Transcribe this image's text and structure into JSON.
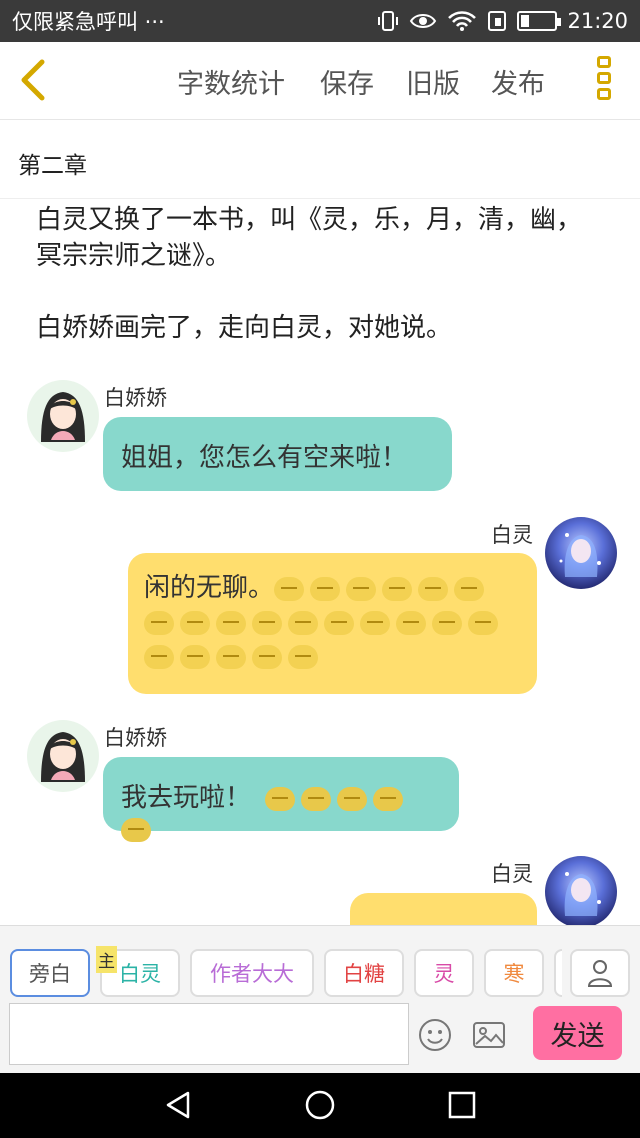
{
  "status": {
    "left_text": "仅限紧急呼叫 ···",
    "time": "21:20",
    "battery_level": 0.25
  },
  "toolbar": {
    "word_count": "字数统计",
    "save": "保存",
    "old_version": "旧版",
    "publish": "发布"
  },
  "chapter": "第二章",
  "narration": [
    "白灵又换了一本书，叫《灵，乐，月，清，幽，冥宗宗师之谜》。",
    "白娇娇画完了，走向白灵，对她说。"
  ],
  "messages": [
    {
      "speaker": "白娇娇",
      "text": "姐姐，您怎么有空来啦！"
    },
    {
      "speaker": "白灵",
      "text": "闲的无聊。"
    },
    {
      "speaker": "白娇娇",
      "text": "我去玩啦！"
    },
    {
      "speaker": "白灵",
      "text": ""
    }
  ],
  "characters": {
    "host_tag": "主",
    "chips": [
      "旁白",
      "白灵",
      "作者大大",
      "白糖",
      "灵",
      "寒"
    ]
  },
  "colors": {
    "chip_text": [
      "#555555",
      "#2bb3a6",
      "#b86cd6",
      "#e24343",
      "#d84aa7",
      "#f08a40"
    ],
    "teal_bubble": "#88d8cc",
    "yellow_bubble": "#ffde6e",
    "send": "#ff6fa2"
  },
  "input": {
    "placeholder": "",
    "send": "发送"
  }
}
